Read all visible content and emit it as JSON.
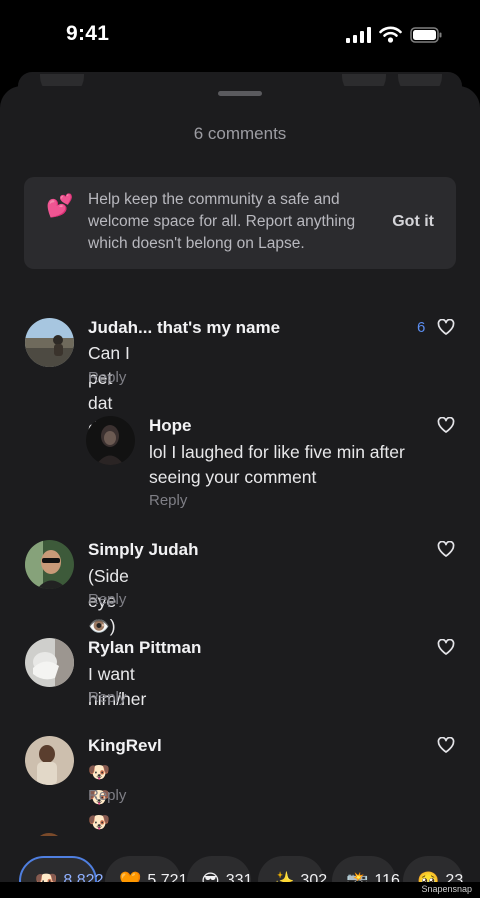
{
  "status": {
    "time": "9:41"
  },
  "sheet": {
    "title": "6 comments"
  },
  "notice": {
    "emoji": "💕",
    "text": "Help keep the community a safe and welcome space for all. Report anything which doesn't belong on Lapse.",
    "button": "Got it"
  },
  "comments": [
    {
      "name": "Judah... that's my name",
      "text": "Can I pet dat dawg",
      "reply": "Reply",
      "likes": "6"
    },
    {
      "name": "Hope",
      "text": "lol I laughed for like five min after seeing your comment",
      "reply": "Reply"
    },
    {
      "name": "Simply Judah",
      "text": "(Side eye 👁️)",
      "reply": "Reply"
    },
    {
      "name": "Rylan Pittman",
      "text": "I want him/her",
      "reply": "Reply"
    },
    {
      "name": "KingRevl",
      "text": "🐶🐶🐶🐶",
      "reply": "Reply"
    }
  ],
  "reactions": [
    {
      "emoji": "🐶",
      "count": "8,822",
      "selected": true
    },
    {
      "emoji": "🧡",
      "count": "5,721"
    },
    {
      "emoji": "😎",
      "count": "331"
    },
    {
      "emoji": "✨",
      "count": "302"
    },
    {
      "emoji": "📸",
      "count": "116"
    },
    {
      "emoji": "🥹",
      "count": "23"
    }
  ],
  "watermark": "Snapensnap"
}
